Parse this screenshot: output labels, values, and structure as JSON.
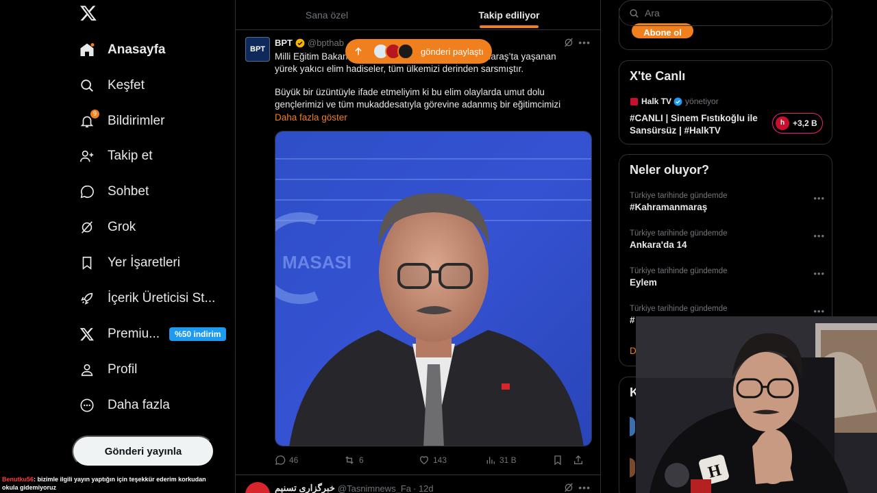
{
  "sidebar": {
    "items": [
      {
        "label": "Anasayfa",
        "icon": "home-icon"
      },
      {
        "label": "Keşfet",
        "icon": "search-icon"
      },
      {
        "label": "Bildirimler",
        "icon": "bell-icon",
        "badge": "9"
      },
      {
        "label": "Takip et",
        "icon": "follow-icon"
      },
      {
        "label": "Sohbet",
        "icon": "chat-icon"
      },
      {
        "label": "Grok",
        "icon": "grok-icon"
      },
      {
        "label": "Yer İşaretleri",
        "icon": "bookmark-icon"
      },
      {
        "label": "İçerik Üreticisi St...",
        "icon": "rocket-icon"
      },
      {
        "label": "Premiu...",
        "icon": "x-logo-icon",
        "promo": "%50 indirim"
      },
      {
        "label": "Profil",
        "icon": "user-icon"
      },
      {
        "label": "Daha fazla",
        "icon": "more-icon"
      }
    ],
    "post_button": "Gönderi yayınla"
  },
  "chat_overlay": {
    "user": "Benutku56",
    "message": ": bizimle ilgili yayın yaptığın için teşekkür ederim korkudan okula gidemiyoruz"
  },
  "tabs": [
    {
      "label": "Sana özel"
    },
    {
      "label": "Takip ediliyor"
    }
  ],
  "share_pill": {
    "label": "gönderi paylaştı"
  },
  "tweet": {
    "avatar_text": "BPT",
    "name": "BPT",
    "handle": "@bpthab",
    "line1_start": "Milli Eğitim Bakan",
    "line1_end": "nmaraş’ta yaşanan",
    "line2": "yürek yakıcı elim hadiseler, tüm ülkemizi derinden sarsmıştır.",
    "paragraph2": "Büyük bir üzüntüyle ifade etmeliyim ki bu elim olaylarda umut dolu gençlerimizi ve tüm mukaddesatıyla görevine adanmış bir eğitimcimizi",
    "show_more": "Daha fazla göster",
    "replies": "46",
    "reposts": "6",
    "likes": "143",
    "views": "31 B"
  },
  "tweet2": {
    "name": "خبرگزاری تسنیم",
    "handle": "@Tasnimnews_Fa",
    "time": "· 12d"
  },
  "search": {
    "placeholder": "Ara"
  },
  "subscribe": {
    "label": "Abone ol"
  },
  "live": {
    "title": "X'te Canlı",
    "host": "Halk TV",
    "host_role": "yönetiyor",
    "stream_title": "#CANLI | Sinem Fıstıkoğlu ile Sansürsüz | #HalkTV",
    "listeners": "+3,2 B"
  },
  "trends": {
    "title": "Neler oluyor?",
    "items": [
      {
        "context": "Türkiye tarihinde gündemde",
        "topic": "#Kahramanmaraş"
      },
      {
        "context": "Türkiye tarihinde gündemde",
        "topic": "Ankara'da 14"
      },
      {
        "context": "Türkiye tarihinde gündemde",
        "topic": "Eylem"
      },
      {
        "context": "Türkiye tarihinde gündemde",
        "topic": "#"
      }
    ],
    "show_more_partial": "D"
  },
  "card3": {
    "title_partial": "K"
  },
  "webcam_shirt_letter": "H",
  "colors": {
    "accent": "#f07f1e",
    "verified": "#1d9bf0",
    "background": "#000000",
    "border": "#2f3336"
  }
}
